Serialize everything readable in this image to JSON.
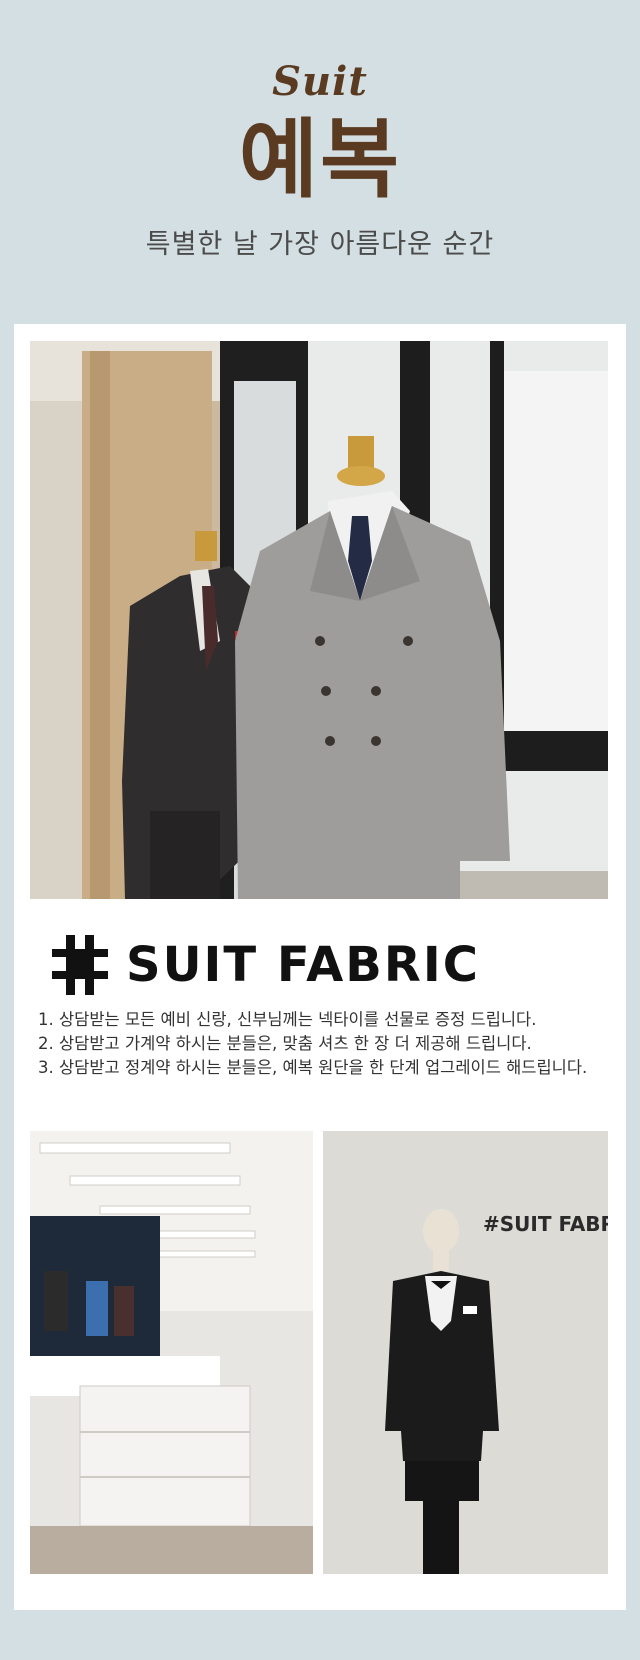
{
  "header": {
    "script_title": "Suit",
    "main_title": "예복",
    "subtitle": "특별한 날 가장 아름다운 순간"
  },
  "brand": {
    "name": "SUIT FABRIC",
    "logo_icon": "hash-logo-icon"
  },
  "wall_sign": {
    "text": "#SUIT FABRIC"
  },
  "benefits": [
    "1. 상담받는 모든 예비 신랑, 신부님께는 넥타이를 선물로 증정 드립니다.",
    "2. 상담받고 가계약 하시는 분들은, 맞춤 셔츠 한 장 더 제공해 드립니다.",
    "3. 상담받고 정계약 하시는 분들은, 예복 원단을 한 단계 업그레이드 해드립니다."
  ],
  "colors": {
    "background": "#d3dfe2",
    "title_brown": "#5a3b22",
    "card": "#ffffff"
  }
}
